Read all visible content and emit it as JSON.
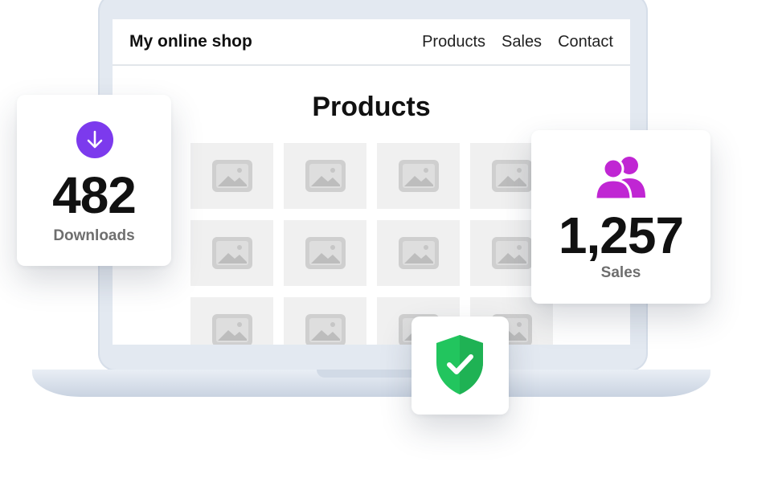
{
  "shop": {
    "brand": "My online shop",
    "nav": [
      "Products",
      "Sales",
      "Contact"
    ],
    "page_title": "Products",
    "tile_count": 12
  },
  "stats": {
    "downloads": {
      "value": "482",
      "label": "Downloads",
      "icon": "arrow-down-icon",
      "color": "#7c3aed"
    },
    "sales": {
      "value": "1,257",
      "label": "Sales",
      "icon": "users-icon",
      "color": "#c026d3"
    }
  },
  "shield": {
    "icon": "shield-check-icon",
    "color": "#22c55e"
  }
}
